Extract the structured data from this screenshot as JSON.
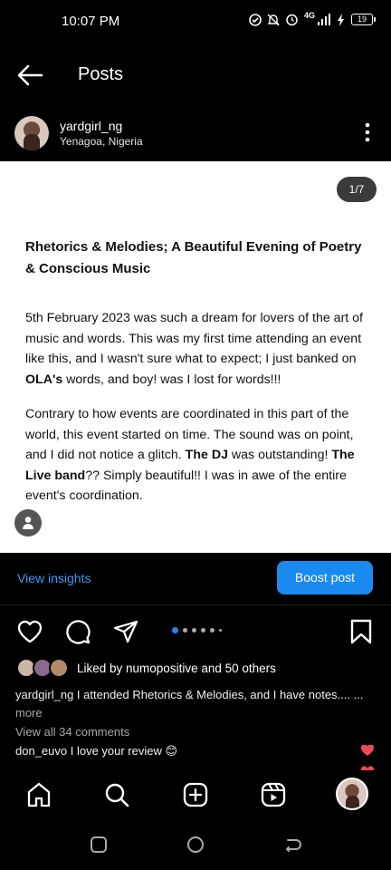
{
  "status_bar": {
    "time": "10:07 PM",
    "network": "4G",
    "battery": "19"
  },
  "header": {
    "title": "Posts"
  },
  "author": {
    "username": "yardgirl_ng",
    "location": "Yenagoa, Nigeria"
  },
  "post_card": {
    "counter": "1/7",
    "title": "Rhetorics & Melodies; A Beautiful Evening of Poetry & Conscious Music",
    "p1_a": "5th February 2023 was such a dream for lovers of the art of music and words. This was my first time attending an event like this, and I wasn't sure what to expect; I just banked on ",
    "p1_b": "OLA's",
    "p1_c": " words, and boy! was I lost for words!!!",
    "p2_a": "Contrary to how events are coordinated in this part of the world, this event started on time. The sound was on point, and I did not notice a glitch. ",
    "p2_b": "The DJ",
    "p2_c": " was outstanding! ",
    "p2_d": "The Live band",
    "p2_e": "?? Simply beautiful!! I was in awe of the entire event's coordination."
  },
  "insights": {
    "view_insights": "View insights",
    "boost_post": "Boost post"
  },
  "carousel": {
    "current": 1,
    "total": 7
  },
  "likes": {
    "text": "Liked by numopositive and 50 others"
  },
  "caption": {
    "text": "yardgirl_ng I attended Rhetorics & Melodies, and I have notes.... ...",
    "more": "more"
  },
  "comments": {
    "view_all": "View all 34 comments",
    "first": "don_euvo I love your review 😊"
  },
  "colors": {
    "accent": "#1a8af0",
    "link": "#3d9bf0",
    "heart": "#ed4956"
  }
}
